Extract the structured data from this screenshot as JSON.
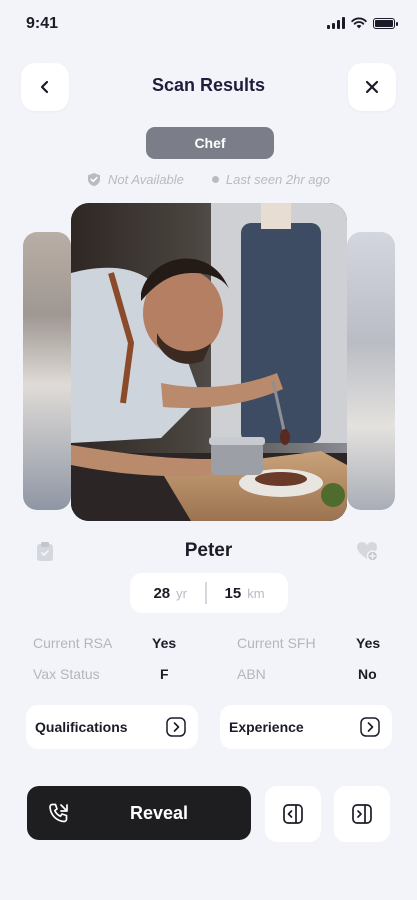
{
  "status_bar": {
    "time": "9:41"
  },
  "header": {
    "title": "Scan Results"
  },
  "role": "Chef",
  "meta": {
    "availability": "Not Available",
    "last_seen": "Last seen 2hr ago"
  },
  "profile": {
    "name": "Peter",
    "age_value": "28",
    "age_unit": "yr",
    "distance_value": "15",
    "distance_unit": "km"
  },
  "details": {
    "current_rsa": {
      "label": "Current RSA",
      "value": "Yes"
    },
    "current_sfh": {
      "label": "Current SFH",
      "value": "Yes"
    },
    "vax_status": {
      "label": "Vax Status",
      "value": "F"
    },
    "abn": {
      "label": "ABN",
      "value": "No"
    }
  },
  "links": {
    "qualifications": "Qualifications",
    "experience": "Experience"
  },
  "actions": {
    "reveal": "Reveal"
  },
  "icons": {
    "back": "chevron-left-icon",
    "close": "close-icon",
    "verified": "shield-check-icon",
    "clipboard": "clipboard-icon",
    "favorite": "heart-plus-icon",
    "phone": "phone-call-icon",
    "previous": "previous-card-icon",
    "next": "next-card-icon"
  },
  "colors": {
    "background": "#f3f4f9",
    "chip": "#7b7e88",
    "primary_dark": "#1e1e20",
    "muted_text": "#b3b5bf"
  }
}
